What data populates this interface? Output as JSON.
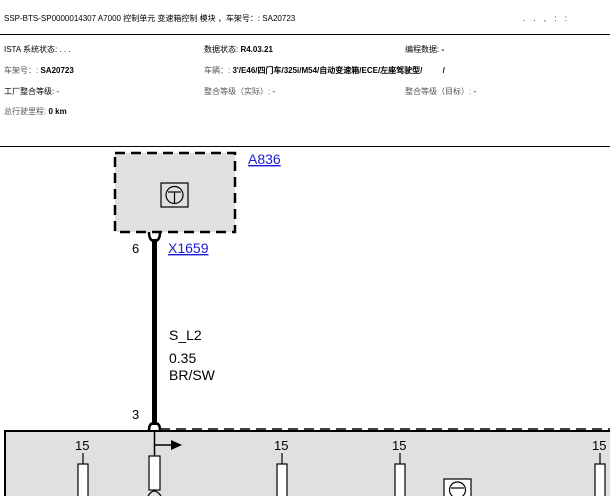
{
  "header": {
    "title": "SSP-BTS-SP0000014307 A7000 控制单元 变速箱控制 模块 ，车架号：: SA20723",
    "dots": ". . , : :",
    "ista_label": "ISTA 系统状态: ",
    "ista_value": ". . .",
    "data_status_label": "数据状态: ",
    "data_status_value": "R4.03.21",
    "programming_label": "编程数据: ",
    "programming_value": "-",
    "vin_label": "车架号：: ",
    "vin_value": "SA20723",
    "vehicle_label": "车辆：: ",
    "vehicle_value": "3'/E46/四门车/325i/M54/自动变速箱/ECE/左座驾驶型/",
    "vehicle_suffix": "/",
    "factory_label": "工厂整合等级: ",
    "factory_value": "-",
    "actual_label": "整合等级（实际）: ",
    "actual_value": "-",
    "target_label": "整合等级（目标）: ",
    "target_value": "-",
    "mileage_label": "总行驶里程: ",
    "mileage_value": "0 km"
  },
  "diagram": {
    "component_id": "A836",
    "connector_id": "X1659",
    "pin_top": "6",
    "pin_bottom": "3",
    "wire_name": "S_L2",
    "wire_size": "0.35",
    "wire_color": "BR/SW",
    "fuse_labels": [
      "15",
      "15",
      "15",
      "15"
    ]
  }
}
